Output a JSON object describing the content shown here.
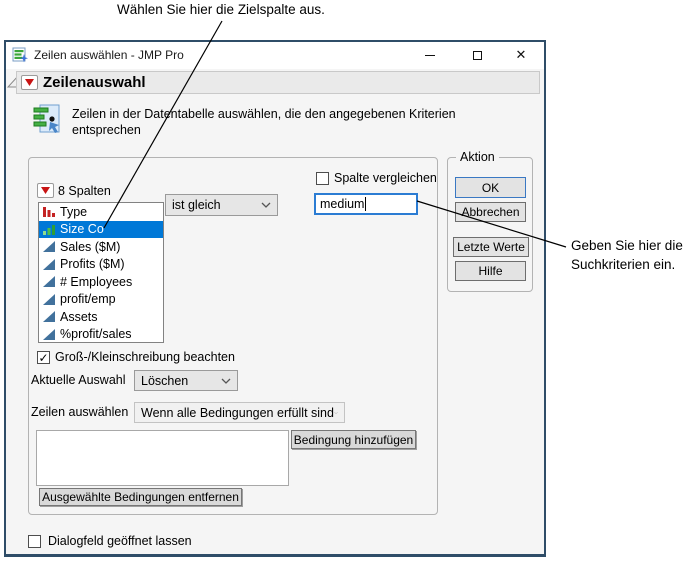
{
  "annotations": {
    "top": "Wählen Sie hier die Zielspalte aus.",
    "right_line1": "Geben Sie hier die",
    "right_line2": "Suchkriterien ein."
  },
  "window": {
    "title": "Zeilen auswählen - JMP Pro",
    "controls": {
      "close": "✕"
    }
  },
  "outline": {
    "header": "Zeilenauswahl",
    "description_line1": "Zeilen in der Datentabelle auswählen, die den angegebenen Kriterien",
    "description_line2": "entsprechen"
  },
  "columns": {
    "header": "8 Spalten",
    "items": [
      {
        "label": "Type",
        "icon": "nominal-bars-red",
        "selected": false
      },
      {
        "label": "Size Co",
        "icon": "ordinal-bars-green",
        "selected": true
      },
      {
        "label": "Sales ($M)",
        "icon": "continuous-triangle-blue",
        "selected": false
      },
      {
        "label": "Profits ($M)",
        "icon": "continuous-triangle-blue",
        "selected": false
      },
      {
        "label": "# Employees",
        "icon": "continuous-triangle-blue",
        "selected": false
      },
      {
        "label": "profit/emp",
        "icon": "continuous-triangle-blue",
        "selected": false
      },
      {
        "label": "Assets",
        "icon": "continuous-triangle-blue",
        "selected": false
      },
      {
        "label": "%profit/sales",
        "icon": "continuous-triangle-blue",
        "selected": false
      }
    ]
  },
  "condition": {
    "operator": "ist gleich",
    "compare_label": "Spalte vergleichen",
    "compare_checked": false,
    "value": "medium"
  },
  "action": {
    "title": "Aktion",
    "ok": "OK",
    "cancel": "Abbrechen",
    "last_values": "Letzte Werte",
    "help": "Hilfe"
  },
  "options": {
    "case_sensitive": "Groß-/Kleinschreibung beachten",
    "case_sensitive_checked": true,
    "current_selection_label": "Aktuelle Auswahl",
    "current_selection_value": "Löschen",
    "select_rows_label": "Zeilen auswählen",
    "select_rows_value": "Wenn alle Bedingungen erfüllt sind",
    "add_condition": "Bedingung hinzufügen",
    "remove_conditions": "Ausgewählte Bedingungen entfernen",
    "keep_open": "Dialogfeld geöffnet lassen",
    "keep_open_checked": false
  },
  "icons": {
    "check": "✓"
  },
  "colors": {
    "selection": "#0078d7",
    "input_focus_border": "#2b7cd3",
    "window_border": "#2f4d68",
    "red_triangle": "#c81414"
  }
}
